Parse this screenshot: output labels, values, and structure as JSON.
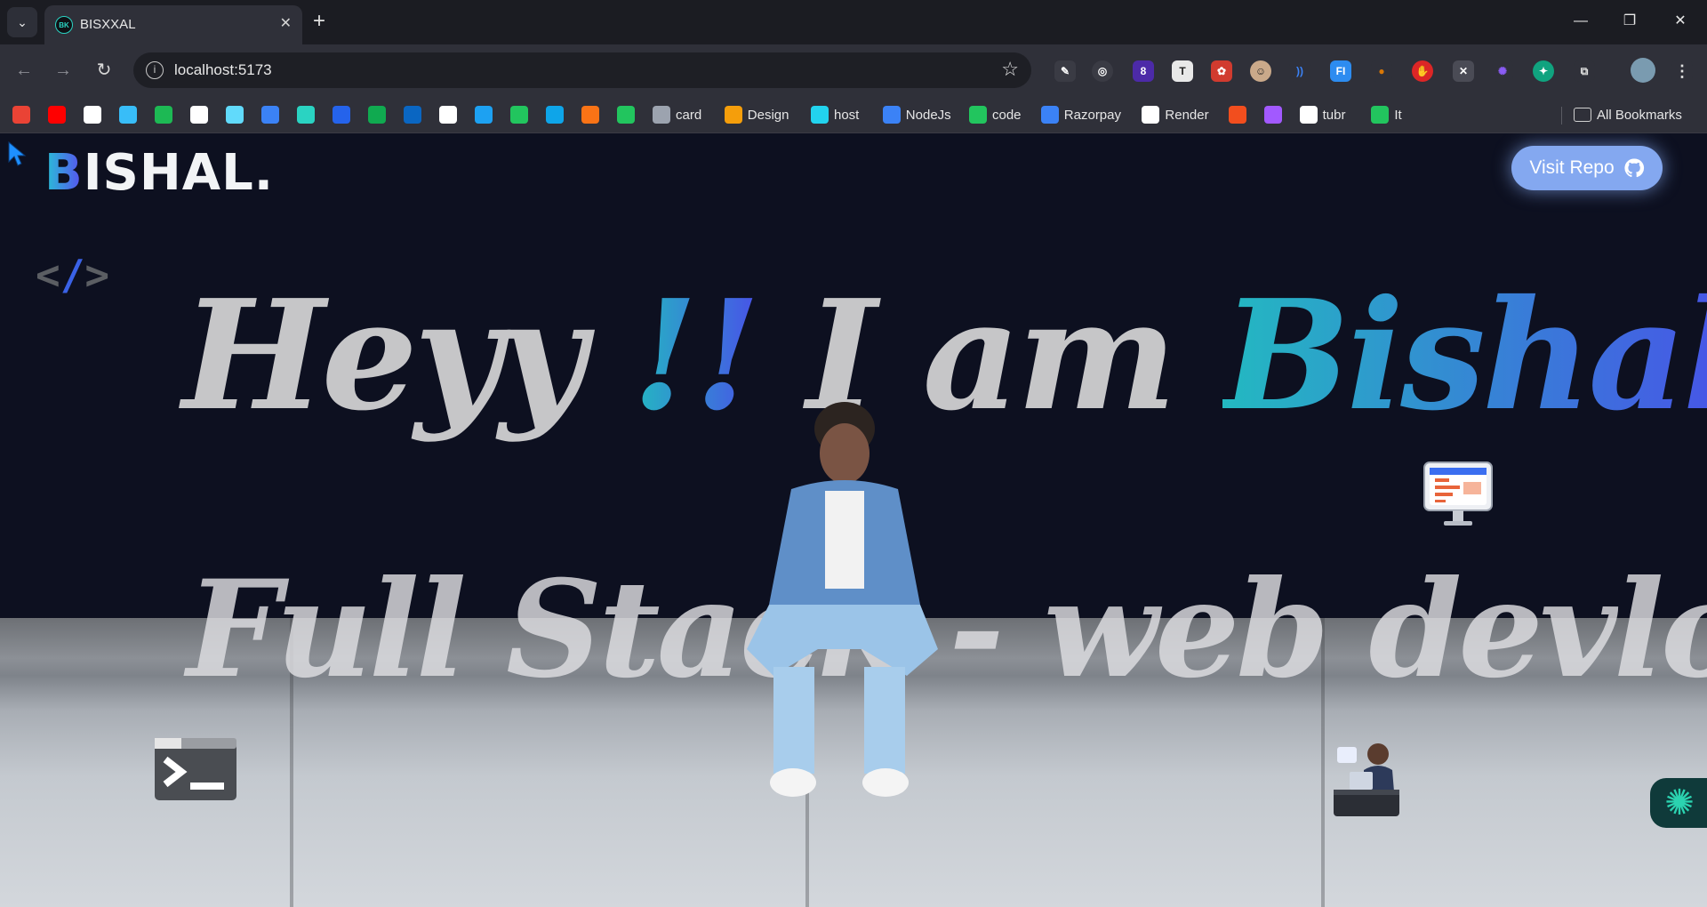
{
  "browser": {
    "tab": {
      "title": "BISXXAL",
      "favicon_text": "BK"
    },
    "url": "localhost:5173",
    "extensions_badge": "8",
    "bookmarks": [
      {
        "label": "",
        "icon": "gmail-icon",
        "color": "#ea4335"
      },
      {
        "label": "",
        "icon": "youtube-icon",
        "color": "#ff0000"
      },
      {
        "label": "",
        "icon": "chatgpt-icon",
        "color": "#ffffff"
      },
      {
        "label": "",
        "icon": "tailwind-icon",
        "color": "#38bdf8"
      },
      {
        "label": "",
        "icon": "spotify-icon",
        "color": "#1db954"
      },
      {
        "label": "",
        "icon": "github-icon",
        "color": "#ffffff"
      },
      {
        "label": "",
        "icon": "react-icon",
        "color": "#61dafb"
      },
      {
        "label": "",
        "icon": "search-icon",
        "color": "#3b82f6"
      },
      {
        "label": "",
        "icon": "bk-icon",
        "color": "#2ad3c2"
      },
      {
        "label": "",
        "icon": "render-icon",
        "color": "#2563eb"
      },
      {
        "label": "",
        "icon": "mongodb-icon",
        "color": "#10aa50"
      },
      {
        "label": "",
        "icon": "linkedin-icon",
        "color": "#0a66c2"
      },
      {
        "label": "",
        "icon": "bank-icon",
        "color": "#ffffff"
      },
      {
        "label": "",
        "icon": "bird-icon",
        "color": "#1da1f2"
      },
      {
        "label": "",
        "icon": "fi-icon",
        "color": "#22c55e"
      },
      {
        "label": "",
        "icon": "is-icon",
        "color": "#0ea5e9"
      },
      {
        "label": "",
        "icon": "firebase-icon",
        "color": "#f97316"
      },
      {
        "label": "",
        "icon": "bolt-icon",
        "color": "#22c55e"
      },
      {
        "label": "card",
        "icon": "gear-icon",
        "color": "#9ca3af"
      },
      {
        "label": "Design",
        "icon": "design-icon",
        "color": "#f59e0b"
      },
      {
        "label": "host",
        "icon": "host-icon",
        "color": "#22d3ee"
      },
      {
        "label": "NodeJs",
        "icon": "dropbox-icon",
        "color": "#3b82f6"
      },
      {
        "label": "code",
        "icon": "code-icon",
        "color": "#22c55e"
      },
      {
        "label": "Razorpay",
        "icon": "razorpay-icon",
        "color": "#3b82f6"
      },
      {
        "label": "Render",
        "icon": "render-icon",
        "color": "#ffffff"
      },
      {
        "label": "",
        "icon": "figma-icon",
        "color": "#f24e1e"
      },
      {
        "label": "",
        "icon": "figma-icon",
        "color": "#a259ff"
      },
      {
        "label": "tubr",
        "icon": "github-icon",
        "color": "#ffffff"
      },
      {
        "label": "It",
        "icon": "asterisk-icon",
        "color": "#22c55e"
      }
    ],
    "all_bookmarks": "All Bookmarks"
  },
  "page": {
    "logo_first": "B",
    "logo_rest": "ISHAL.",
    "visit_repo": "Visit Repo",
    "hero": {
      "heyy": "Heyy",
      "bangs": "!!",
      "i_am": "I am",
      "name": "Bishal",
      "subtitle": "Full Stack - web devloper"
    }
  },
  "colors": {
    "accent_start": "#23b9c1",
    "accent_end": "#4852e8",
    "button": "#84a8f0",
    "background": "#0d1020"
  }
}
